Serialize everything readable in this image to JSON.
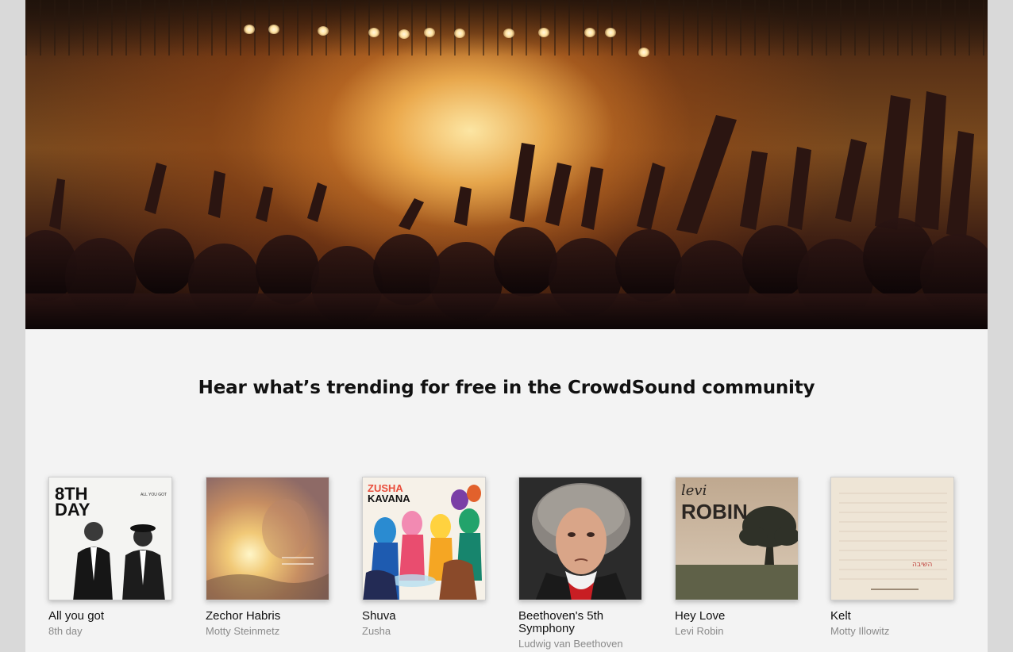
{
  "hero": {
    "image_name": "concert-crowd-image"
  },
  "headline": "Hear what’s trending for free in the CrowdSound community",
  "albums": [
    {
      "title": "All you got",
      "artist": "8th day",
      "cover_text": [
        "8TH",
        "DAY"
      ],
      "cover_small": "ALL YOU GOT"
    },
    {
      "title": "Zechor Habris",
      "artist": "Motty Steinmetz"
    },
    {
      "title": "Shuva",
      "artist": "Zusha",
      "cover_text": [
        "ZUSHA",
        "KAVANA"
      ]
    },
    {
      "title": "Beethoven's 5th Symphony",
      "artist": "Ludwig van Beethoven"
    },
    {
      "title": "Hey Love",
      "artist": "Levi Robin",
      "cover_text": [
        "levi",
        "ROBIN"
      ]
    },
    {
      "title": "Kelt",
      "artist": "Motty Illowitz",
      "cover_text": [
        "השיבה"
      ]
    }
  ],
  "colors": {
    "page_bg": "#f3f3f3",
    "outer_bg": "#d9d9d9",
    "title_text": "#111111",
    "artist_text": "#8a8a8a"
  }
}
